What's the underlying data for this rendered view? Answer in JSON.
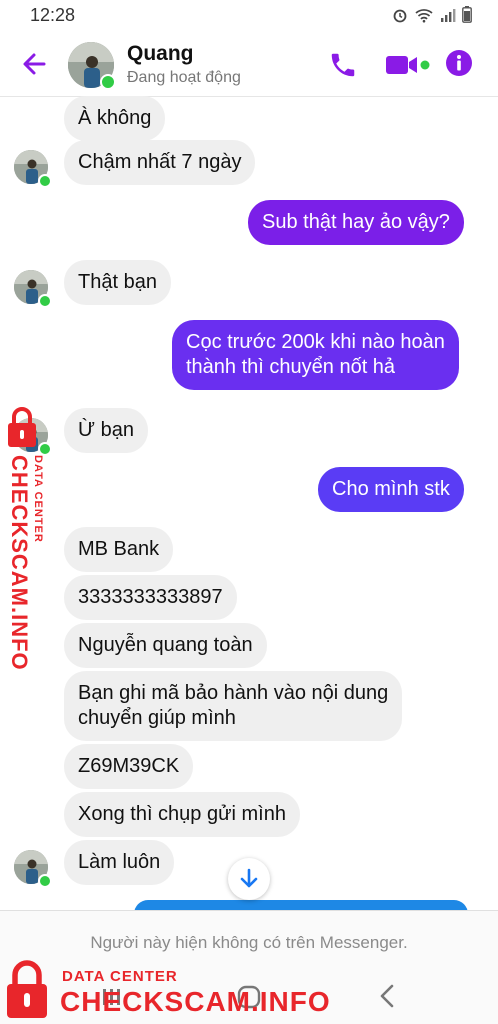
{
  "status_bar": {
    "time": "12:28"
  },
  "header": {
    "contact_name": "Quang",
    "contact_status": "Đang hoạt động"
  },
  "messages": [
    {
      "side": "in",
      "text": "À không"
    },
    {
      "side": "in",
      "text": "Chậm nhất 7 ngày"
    },
    {
      "side": "out",
      "text": "Sub thật hay ảo vậy?"
    },
    {
      "side": "in",
      "text": "Thật bạn"
    },
    {
      "side": "out",
      "lines": [
        "Cọc trước 200k khi nào hoàn",
        "thành thì chuyển nốt hả"
      ]
    },
    {
      "side": "in",
      "text": "Ừ bạn"
    },
    {
      "side": "out",
      "text": "Cho mình stk"
    },
    {
      "side": "in",
      "text": "MB Bank"
    },
    {
      "side": "in",
      "text": "3333333333897"
    },
    {
      "side": "in",
      "text": "Nguyễn quang toàn"
    },
    {
      "side": "in",
      "lines": [
        "Bạn ghi mã bảo hành vào nội dung",
        "chuyển giúp mình"
      ]
    },
    {
      "side": "in",
      "text": "Z69M39CK"
    },
    {
      "side": "in",
      "text": "Xong thì chụp gửi mình"
    },
    {
      "side": "in",
      "text": "Làm luôn"
    }
  ],
  "footer": {
    "notice": "Người này hiện không có trên Messenger."
  },
  "watermark": {
    "brand": "CHECKSCAM.INFO",
    "subtitle": "DATA CENTER"
  },
  "colors": {
    "accent": "#7b1fe8",
    "online": "#31cc46",
    "watermark": "#e8262b"
  }
}
